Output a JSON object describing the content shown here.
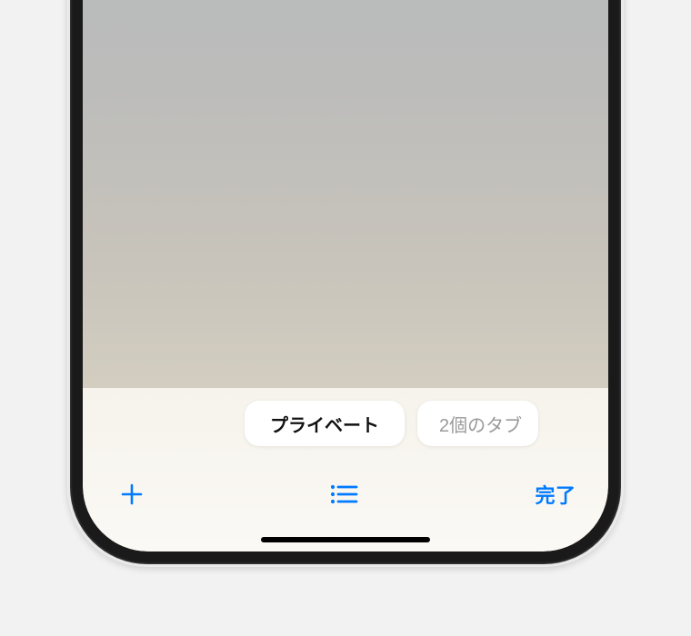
{
  "tabGroups": {
    "privateLabel": "プライベート",
    "tabsCountLabel": "2個のタブ"
  },
  "toolbar": {
    "doneLabel": "完了"
  },
  "colors": {
    "accent": "#007aff"
  }
}
